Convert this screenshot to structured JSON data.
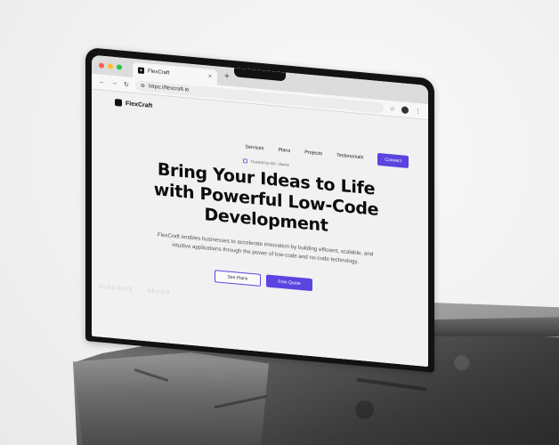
{
  "browser": {
    "tab_title": "FlexCraft",
    "tab_close": "×",
    "new_tab": "+",
    "url": "https://flexcraft.io",
    "nav_back": "←",
    "nav_forward": "→",
    "reload": "↻",
    "star": "☆",
    "menu": "⋮",
    "traffic_lights": [
      "#ff5f57",
      "#febc2e",
      "#28c840"
    ]
  },
  "site": {
    "brand": "FlexCraft",
    "nav": [
      "Services",
      "Plans",
      "Projects",
      "Testimonials"
    ],
    "connect_label": "Connect",
    "badge": "Trusted by 60+ clients",
    "hero_lines": [
      "Bring Your Ideas to Life",
      "with Powerful Low-Code",
      "Development"
    ],
    "hero_sub_1": "FlexCraft enables businesses to accelerate innovation by building efficient, scalable, and",
    "hero_sub_2": "intuitive applications through the power of low-code and no-code technology.",
    "cta_plans": "See Plans",
    "cta_quote": "Free Quote",
    "logos": [
      "ALGENIUS",
      "NEXOR"
    ]
  },
  "colors": {
    "accent": "#5b45e0"
  }
}
